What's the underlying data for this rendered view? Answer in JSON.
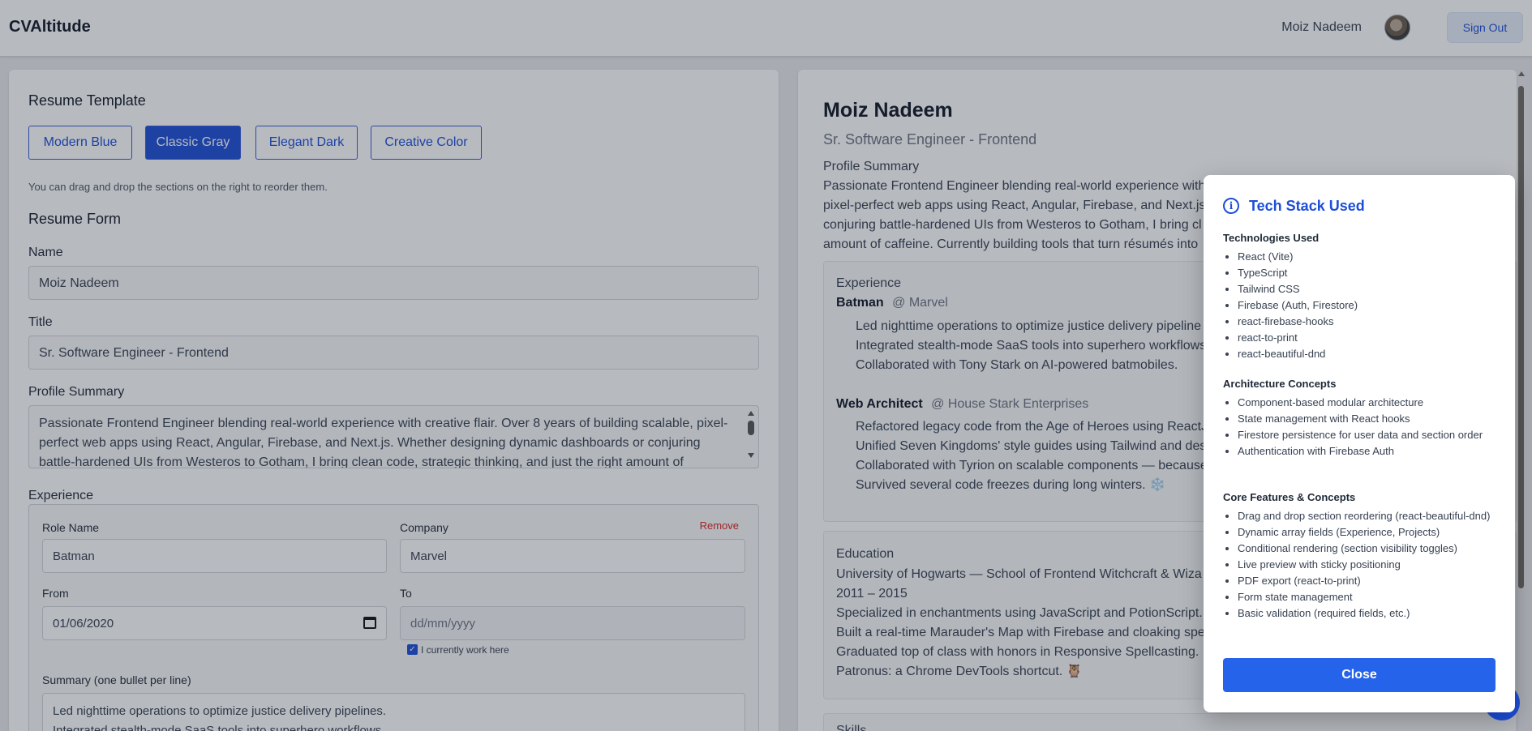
{
  "header": {
    "brand": "CVAltitude",
    "user_name": "Moiz Nadeem",
    "sign_out": "Sign Out"
  },
  "templates": {
    "heading": "Resume Template",
    "options": [
      "Modern Blue",
      "Classic Gray",
      "Elegant Dark",
      "Creative Color"
    ],
    "selected": "Classic Gray",
    "hint": "You can drag and drop the sections on the right to reorder them."
  },
  "form": {
    "heading": "Resume Form",
    "name_label": "Name",
    "name_value": "Moiz Nadeem",
    "title_label": "Title",
    "title_value": "Sr. Software Engineer - Frontend",
    "summary_label": "Profile Summary",
    "summary_value": "Passionate Frontend Engineer blending real-world experience with creative flair. Over 8 years of building scalable, pixel-perfect web apps using React, Angular, Firebase, and Next.js. Whether designing dynamic dashboards or conjuring battle-hardened UIs from Westeros to Gotham, I bring clean code, strategic thinking, and just the right amount of caffeine.",
    "experience_label": "Experience",
    "experience": {
      "role_label": "Role Name",
      "role_value": "Batman",
      "company_label": "Company",
      "company_value": "Marvel",
      "remove": "Remove",
      "from_label": "From",
      "from_value": "01/06/2020",
      "to_label": "To",
      "to_placeholder": "dd/mm/yyyy",
      "current_label": "I currently work here",
      "summary_label": "Summary (one bullet per line)",
      "summary_lines": [
        "Led nighttime operations to optimize justice delivery pipelines.",
        "Integrated stealth-mode SaaS tools into superhero workflows."
      ]
    }
  },
  "preview": {
    "name": "Moiz Nadeem",
    "title": "Sr. Software Engineer - Frontend",
    "summary_heading": "Profile Summary",
    "summary_lines": [
      "Passionate Frontend Engineer blending real-world experience with",
      "pixel-perfect web apps using React, Angular, Firebase, and Next.js.",
      "conjuring battle-hardened UIs from Westeros to Gotham, I bring cl",
      "amount of caffeine. Currently building tools that turn résumés into"
    ],
    "experience_heading": "Experience",
    "jobs": [
      {
        "role": "Batman",
        "company": "@ Marvel",
        "bullets": [
          "Led nighttime operations to optimize justice delivery pipeline",
          "Integrated stealth-mode SaaS tools into superhero workflows",
          "Collaborated with Tony Stark on AI-powered batmobiles."
        ]
      },
      {
        "role": "Web Architect",
        "company": "@ House Stark Enterprises",
        "bullets": [
          "Refactored legacy code from the Age of Heroes using ReactJS",
          "Unified Seven Kingdoms' style guides using Tailwind and des",
          "Collaborated with Tyrion on scalable components — because",
          "Survived several code freezes during long winters. ❄️"
        ]
      }
    ],
    "education_heading": "Education",
    "education_lines": [
      "University of Hogwarts — School of Frontend Witchcraft & Wiza",
      "2011 – 2015",
      "Specialized in enchantments using JavaScript and PotionScript.",
      "Built a real-time Marauder's Map with Firebase and cloaking spe",
      "Graduated top of class with honors in Responsive Spellcasting.",
      "Patronus: a Chrome DevTools shortcut. 🦉"
    ],
    "skills_heading": "Skills"
  },
  "modal": {
    "title": "Tech Stack Used",
    "sections": [
      {
        "heading": "Technologies Used",
        "items": [
          "React (Vite)",
          "TypeScript",
          "Tailwind CSS",
          "Firebase (Auth, Firestore)",
          "react-firebase-hooks",
          "react-to-print",
          "react-beautiful-dnd"
        ]
      },
      {
        "heading": "Architecture Concepts",
        "items": [
          "Component-based modular architecture",
          "State management with React hooks",
          "Firestore persistence for user data and section order",
          "Authentication with Firebase Auth"
        ]
      },
      {
        "heading": "Core Features & Concepts",
        "items": [
          "Drag and drop section reordering (react-beautiful-dnd)",
          "Dynamic array fields (Experience, Projects)",
          "Conditional rendering (section visibility toggles)",
          "Live preview with sticky positioning",
          "PDF export (react-to-print)",
          "Form state management",
          "Basic validation (required fields, etc.)"
        ]
      }
    ],
    "close": "Close"
  },
  "colors": {
    "accent": "#1d4ed8",
    "button_primary": "#2563eb",
    "danger": "#dc2626"
  }
}
